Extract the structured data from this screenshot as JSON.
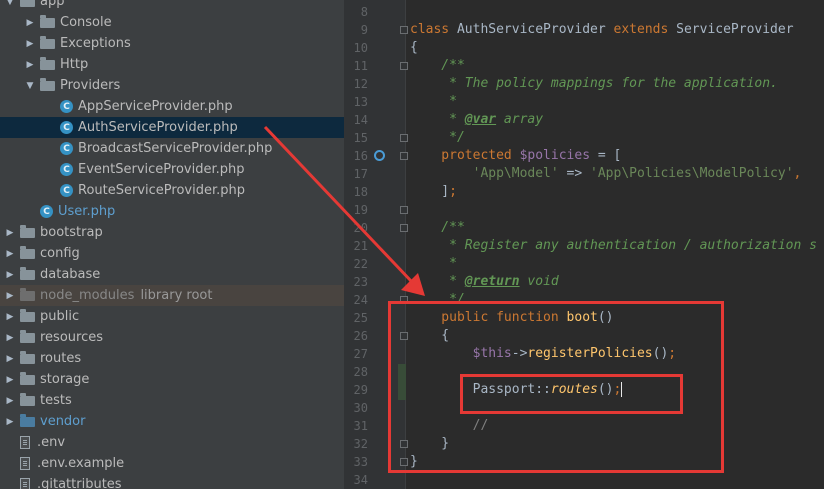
{
  "project_tree": [
    {
      "label": "app",
      "kind": "folder",
      "expanded": true
    },
    {
      "label": "Console",
      "kind": "folder",
      "expanded": false
    },
    {
      "label": "Exceptions",
      "kind": "folder",
      "expanded": false
    },
    {
      "label": "Http",
      "kind": "folder",
      "expanded": false
    },
    {
      "label": "Providers",
      "kind": "folder",
      "expanded": true
    },
    {
      "label": "AppServiceProvider.php",
      "kind": "class"
    },
    {
      "label": "AuthServiceProvider.php",
      "kind": "class",
      "selected": true
    },
    {
      "label": "BroadcastServiceProvider.php",
      "kind": "class"
    },
    {
      "label": "EventServiceProvider.php",
      "kind": "class"
    },
    {
      "label": "RouteServiceProvider.php",
      "kind": "class"
    },
    {
      "label": "User.php",
      "kind": "class"
    },
    {
      "label": "bootstrap",
      "kind": "folder",
      "expanded": false
    },
    {
      "label": "config",
      "kind": "folder",
      "expanded": false
    },
    {
      "label": "database",
      "kind": "folder",
      "expanded": false
    },
    {
      "label": "node_modules",
      "kind": "folder",
      "expanded": false,
      "excluded": true,
      "extra": "library root"
    },
    {
      "label": "public",
      "kind": "folder",
      "expanded": false
    },
    {
      "label": "resources",
      "kind": "folder",
      "expanded": false
    },
    {
      "label": "routes",
      "kind": "folder",
      "expanded": false
    },
    {
      "label": "storage",
      "kind": "folder",
      "expanded": false
    },
    {
      "label": "tests",
      "kind": "folder",
      "expanded": false
    },
    {
      "label": "vendor",
      "kind": "folder",
      "expanded": false
    },
    {
      "label": ".env",
      "kind": "file"
    },
    {
      "label": ".env.example",
      "kind": "file"
    },
    {
      "label": ".gitattributes",
      "kind": "file"
    }
  ],
  "editor": {
    "line_numbers": [
      "8",
      "9",
      "10",
      "11",
      "12",
      "13",
      "14",
      "15",
      "16",
      "17",
      "18",
      "19",
      "20",
      "21",
      "22",
      "23",
      "24",
      "25",
      "26",
      "27",
      "28",
      "29",
      "30",
      "31",
      "32",
      "33",
      "34"
    ],
    "lines": [
      {
        "tokens": []
      },
      {
        "tokens": [
          [
            "kw",
            "class "
          ],
          [
            "plain",
            "AuthServiceProvider "
          ],
          [
            "kw",
            "extends "
          ],
          [
            "plain",
            "ServiceProvider"
          ]
        ]
      },
      {
        "tokens": [
          [
            "plain",
            "{"
          ]
        ]
      },
      {
        "tokens": [
          [
            "cmt",
            "    /**"
          ]
        ]
      },
      {
        "tokens": [
          [
            "cmt",
            "     * The policy mappings for the application."
          ]
        ]
      },
      {
        "tokens": [
          [
            "cmt",
            "     *"
          ]
        ]
      },
      {
        "tokens": [
          [
            "cmt",
            "     * "
          ],
          [
            "doctag",
            "@var"
          ],
          [
            "cmt",
            " array"
          ]
        ]
      },
      {
        "tokens": [
          [
            "cmt",
            "     */"
          ]
        ]
      },
      {
        "tokens": [
          [
            "kw",
            "    protected "
          ],
          [
            "var",
            "$policies"
          ],
          [
            "plain",
            " = ["
          ]
        ]
      },
      {
        "tokens": [
          [
            "str",
            "        'App\\Model'"
          ],
          [
            "plain",
            " => "
          ],
          [
            "str",
            "'App\\Policies\\ModelPolicy'"
          ],
          [
            "kw",
            ","
          ]
        ]
      },
      {
        "tokens": [
          [
            "plain",
            "    ]"
          ],
          [
            "kw",
            ";"
          ]
        ]
      },
      {
        "tokens": []
      },
      {
        "tokens": [
          [
            "cmt",
            "    /**"
          ]
        ]
      },
      {
        "tokens": [
          [
            "cmt",
            "     * Register any authentication / authorization s"
          ]
        ]
      },
      {
        "tokens": [
          [
            "cmt",
            "     *"
          ]
        ]
      },
      {
        "tokens": [
          [
            "cmt",
            "     * "
          ],
          [
            "doctag",
            "@return"
          ],
          [
            "cmt",
            " void"
          ]
        ]
      },
      {
        "tokens": [
          [
            "cmt",
            "     */"
          ]
        ]
      },
      {
        "tokens": [
          [
            "kw",
            "    public function "
          ],
          [
            "fn",
            "boot"
          ],
          [
            "plain",
            "()"
          ]
        ]
      },
      {
        "tokens": [
          [
            "plain",
            "    {"
          ]
        ]
      },
      {
        "tokens": [
          [
            "var",
            "        $this"
          ],
          [
            "plain",
            "->"
          ],
          [
            "fn",
            "registerPolicies"
          ],
          [
            "plain",
            "()"
          ],
          [
            "kw",
            ";"
          ]
        ]
      },
      {
        "tokens": []
      },
      {
        "tokens": [
          [
            "plain",
            "        Passport::"
          ],
          [
            "sfn",
            "routes"
          ],
          [
            "plain",
            "()"
          ],
          [
            "kw",
            ";"
          ],
          [
            "caret",
            ""
          ]
        ]
      },
      {
        "tokens": []
      },
      {
        "tokens": [
          [
            "grey",
            "        //"
          ]
        ]
      },
      {
        "tokens": [
          [
            "plain",
            "    }"
          ]
        ]
      },
      {
        "tokens": [
          [
            "plain",
            "}"
          ]
        ]
      },
      {
        "tokens": []
      }
    ]
  }
}
